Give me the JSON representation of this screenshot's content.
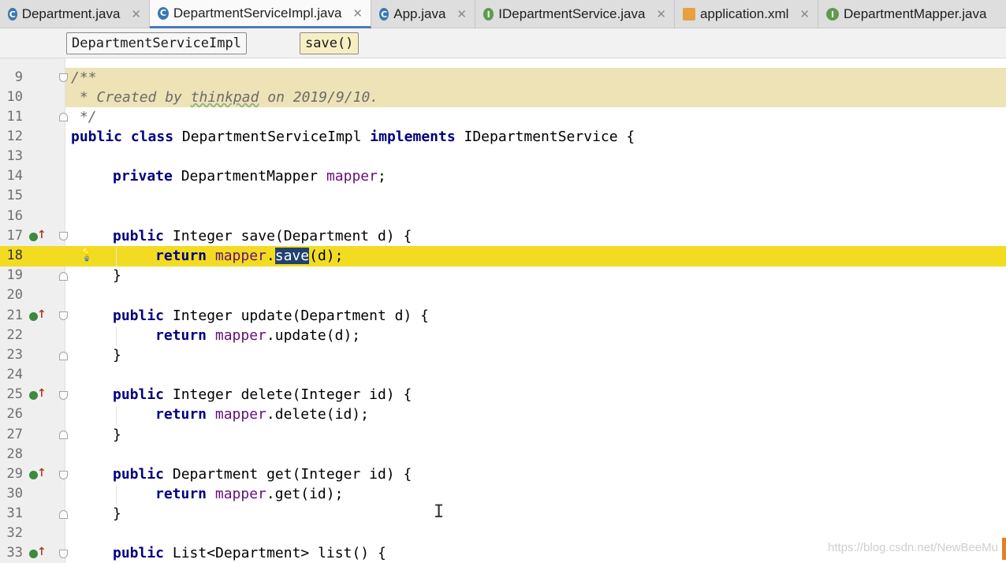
{
  "tabs": [
    {
      "label": "Department.java",
      "icon": "class-icon",
      "letter": "C",
      "active": false
    },
    {
      "label": "DepartmentServiceImpl.java",
      "icon": "class-icon",
      "letter": "C",
      "active": true
    },
    {
      "label": "App.java",
      "icon": "class-icon",
      "letter": "C",
      "active": false
    },
    {
      "label": "IDepartmentService.java",
      "icon": "interface-icon",
      "letter": "I",
      "active": false
    },
    {
      "label": "application.xml",
      "icon": "xml-file-icon",
      "letter": "",
      "active": false
    },
    {
      "label": "DepartmentMapper.java",
      "icon": "interface-icon",
      "letter": "I",
      "active": false
    }
  ],
  "close_glyph": "✕",
  "breadcrumb": {
    "class_name": "DepartmentServiceImpl",
    "method": "save()"
  },
  "line_numbers": [
    "9",
    "10",
    "11",
    "12",
    "13",
    "14",
    "15",
    "16",
    "17",
    "18",
    "19",
    "20",
    "21",
    "22",
    "23",
    "24",
    "25",
    "26",
    "27",
    "28",
    "29",
    "30",
    "31",
    "32",
    "33"
  ],
  "code": {
    "l9": "/**",
    "l10_a": " * Created by ",
    "l10_b": "thinkpad",
    "l10_c": " on 2019/9/10.",
    "l11": " */",
    "l12_kw": "public class",
    "l12_a": " DepartmentServiceImpl ",
    "l12_kw2": "implements",
    "l12_b": " IDepartmentService {",
    "l14_kw": "private",
    "l14_a": " DepartmentMapper ",
    "l14_f": "mapper",
    "l14_b": ";",
    "l17_kw": "public",
    "l17_a": " Integer save(Department d) {",
    "l18_kw": "return",
    "l18_f": "mapper",
    "l18_a": ".",
    "l18_sel": "save",
    "l18_b": "(d);",
    "close_brace": "}",
    "l21_kw": "public",
    "l21_a": " Integer update(Department d) {",
    "l22_kw": "return",
    "l22_f": "mapper",
    "l22_a": ".update(d);",
    "l25_kw": "public",
    "l25_a": " Integer delete(Integer id) {",
    "l26_kw": "return",
    "l26_f": "mapper",
    "l26_a": ".delete(id);",
    "l29_kw": "public",
    "l29_a": " Department get(Integer id) {",
    "l30_kw": "return",
    "l30_f": "mapper",
    "l30_a": ".get(id);",
    "l33_kw": "public",
    "l33_a": " List<Department> list() {"
  },
  "colors": {
    "keyword": "#000080",
    "field": "#660e7a",
    "current_line": "#f2dc22",
    "comment_bg": "#ede3b6",
    "selection": "#21426f"
  },
  "watermark": "https://blog.csdn.net/NewBeeMu",
  "bulb_glyph": "💡",
  "cursor_glyph": "I"
}
